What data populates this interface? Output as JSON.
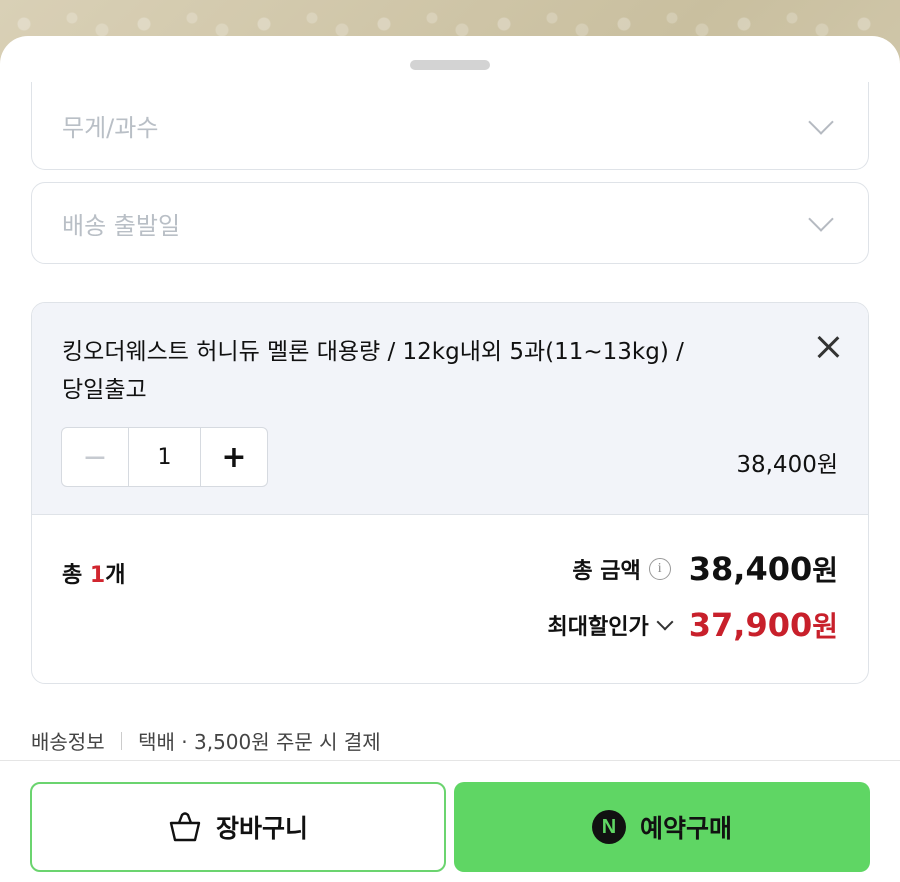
{
  "options": {
    "weight_placeholder": "무게/과수",
    "ship_date_placeholder": "배송 출발일"
  },
  "item": {
    "name_line1": "킹오더웨스트 허니듀 멜론 대용량 / 12kg내외 5과(11~13kg) /",
    "name_line2": "당일출고",
    "quantity": "1",
    "minus": "−",
    "plus": "+",
    "price": "38,400원"
  },
  "summary": {
    "total_prefix": "총 ",
    "total_count": "1",
    "total_suffix": "개",
    "total_amount_label": "총 금액",
    "total_amount_number": "38,400",
    "max_discount_label": "최대할인가",
    "max_discount_number": "37,900",
    "won": "원"
  },
  "shipping": {
    "label": "배송정보",
    "detail": "택배 · 3,500원 주문 시 결제"
  },
  "buttons": {
    "cart_label": "장바구니",
    "buy_label": "예약구매",
    "buy_icon_letter": "N"
  },
  "colors": {
    "accent_green": "#5fd664",
    "price_red": "#c8202b"
  }
}
